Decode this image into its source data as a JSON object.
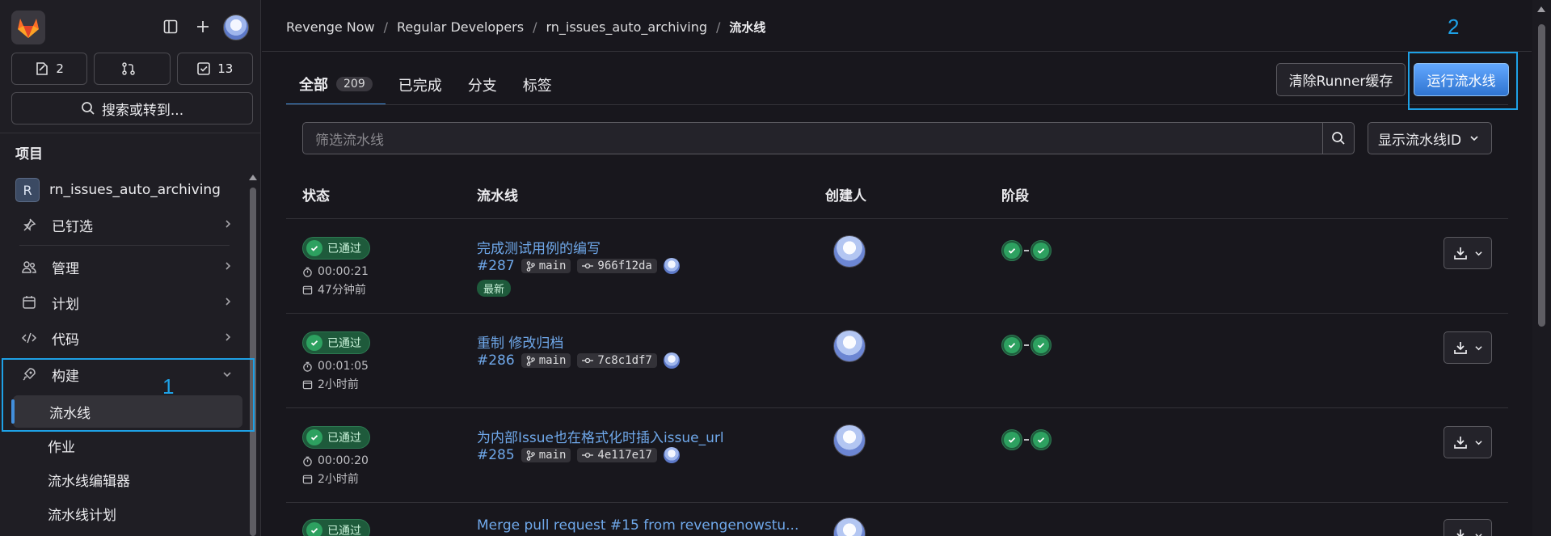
{
  "sidebar": {
    "counters": [
      {
        "icon": "issues-icon",
        "value": "2"
      },
      {
        "icon": "merge-request-icon",
        "value": ""
      },
      {
        "icon": "todo-icon",
        "value": "13"
      }
    ],
    "search_label": "搜索或转到...",
    "section_title": "项目",
    "project": {
      "badge": "R",
      "name": "rn_issues_auto_archiving"
    },
    "pinned": "已钉选",
    "nav": [
      {
        "label": "管理",
        "icon": "users-icon"
      },
      {
        "label": "计划",
        "icon": "calendar-icon"
      },
      {
        "label": "代码",
        "icon": "code-icon"
      },
      {
        "label": "构建",
        "icon": "rocket-icon"
      }
    ],
    "build_subitems": [
      "流水线",
      "作业",
      "流水线编辑器",
      "流水线计划"
    ]
  },
  "annotations": {
    "label_1": "1",
    "label_2": "2"
  },
  "breadcrumb": [
    "Revenge Now",
    "Regular Developers",
    "rn_issues_auto_archiving",
    "流水线"
  ],
  "tabs": [
    {
      "label": "全部",
      "count": "209"
    },
    {
      "label": "已完成"
    },
    {
      "label": "分支"
    },
    {
      "label": "标签"
    }
  ],
  "actions": {
    "clear_cache": "清除Runner缓存",
    "run_pipeline": "运行流水线"
  },
  "filter": {
    "placeholder": "筛选流水线",
    "id_select": "显示流水线ID"
  },
  "table": {
    "headers": [
      "状态",
      "流水线",
      "创建人",
      "阶段"
    ],
    "rows": [
      {
        "status": "已通过",
        "duration": "00:00:21",
        "ago": "47分钟前",
        "title": "完成测试用例的编写",
        "id": "#287",
        "branch": "main",
        "commit": "966f12da",
        "latest": "最新"
      },
      {
        "status": "已通过",
        "duration": "00:01:05",
        "ago": "2小时前",
        "title": "重制 修改归档",
        "id": "#286",
        "branch": "main",
        "commit": "7c8c1df7"
      },
      {
        "status": "已通过",
        "duration": "00:00:20",
        "ago": "2小时前",
        "title": "为内部Issue也在格式化时插入issue_url",
        "id": "#285",
        "branch": "main",
        "commit": "4e117e17"
      },
      {
        "status": "已通过",
        "title": "Merge pull request #15 from revengenowstu..."
      }
    ]
  },
  "colors": {
    "accent": "#428fdc",
    "success": "#2da160",
    "highlight": "#1ea1e6"
  }
}
